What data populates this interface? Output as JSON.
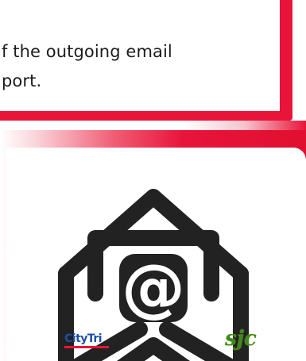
{
  "text_card": {
    "line1": "f the outgoing email",
    "line2": "port."
  },
  "logos": {
    "left": "CityTri",
    "right": "sjc"
  },
  "colors": {
    "accent": "#e8143a",
    "icon": "#222222",
    "logo_blue": "#1d4fa8",
    "logo_green": "#3d8a1e"
  },
  "icons": {
    "envelope": "open-envelope-at-icon"
  }
}
